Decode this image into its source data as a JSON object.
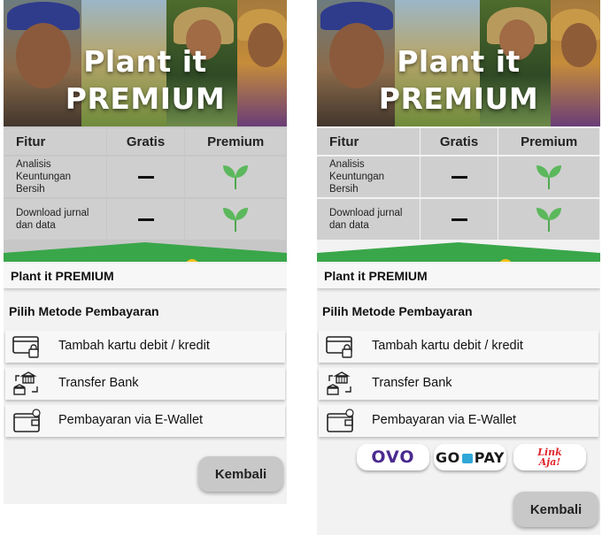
{
  "hero": {
    "title_line1": "Plant it",
    "title_line2": "PREMIUM"
  },
  "features_table": {
    "headers": [
      "Fitur",
      "Gratis",
      "Premium"
    ],
    "rows": [
      {
        "feature": "Analisis Keuntungan Bersih",
        "free": "—",
        "premium": "leaf-icon"
      },
      {
        "feature": "Download jurnal dan data",
        "free": "—",
        "premium": "leaf-icon"
      }
    ]
  },
  "sheet": {
    "title": "Plant it PREMIUM",
    "subtitle": "Pilih Metode Pembayaran",
    "options": [
      {
        "label": "Tambah kartu debit / kredit",
        "icon": "credit-card-lock-icon"
      },
      {
        "label": "Transfer Bank",
        "icon": "bank-transfer-icon"
      },
      {
        "label": "Pembayaran via E-Wallet",
        "icon": "e-wallet-icon"
      }
    ],
    "back_button": "Kembali"
  },
  "ewallets": {
    "ovo": "OVO",
    "gopay_left": "GO",
    "gopay_right": "PAY",
    "linkaja_line1": "Link",
    "linkaja_line2": "Aja!"
  },
  "colors": {
    "accent_green": "#3aa64a",
    "leaf_green": "#5cb85c",
    "ovo_purple": "#4b2a8f",
    "linkaja_red": "#e0252c"
  }
}
